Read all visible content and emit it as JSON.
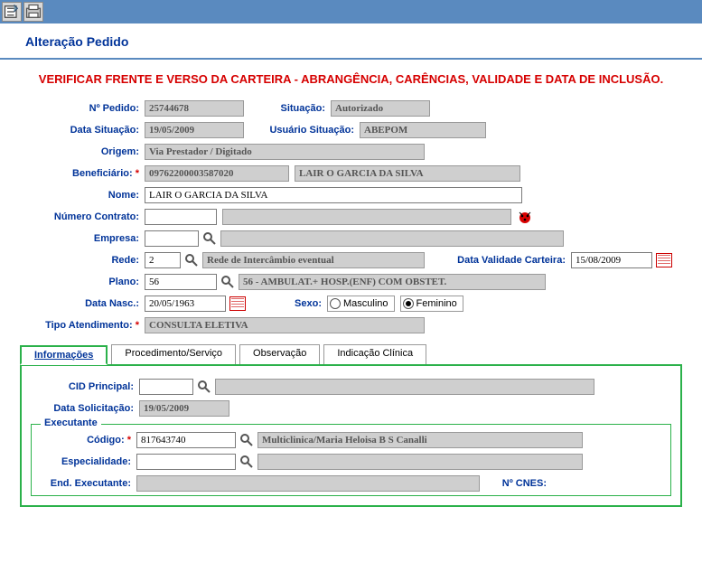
{
  "page": {
    "title": "Alteração Pedido",
    "alert": "VERIFICAR FRENTE E VERSO DA CARTEIRA - ABRANGÊNCIA, CARÊNCIAS, VALIDADE E DATA DE INCLUSÃO."
  },
  "labels": {
    "nopedido": "Nº Pedido:",
    "situacao": "Situação:",
    "data_situacao": "Data Situação:",
    "usuario_situacao": "Usuário Situação:",
    "origem": "Origem:",
    "beneficiario": "Beneficiário:",
    "nome": "Nome:",
    "numero_contrato": "Número Contrato:",
    "empresa": "Empresa:",
    "rede": "Rede:",
    "data_validade_carteira": "Data Validade Carteira:",
    "plano": "Plano:",
    "data_nasc": "Data Nasc.:",
    "sexo": "Sexo:",
    "masculino": "Masculino",
    "feminino": "Feminino",
    "tipo_atendimento": "Tipo Atendimento:",
    "cid_principal": "CID Principal:",
    "data_solicitacao": "Data Solicitação:",
    "executante": "Executante",
    "codigo": "Código:",
    "especialidade": "Especialidade:",
    "end_executante": "End. Executante:",
    "no_cnes": "Nº CNES:"
  },
  "values": {
    "nopedido": "25744678",
    "situacao": "Autorizado",
    "data_situacao": "19/05/2009",
    "usuario_situacao": "ABEPOM",
    "origem": "Via Prestador / Digitado",
    "beneficiario_cod": "09762200003587020",
    "beneficiario_nome": "LAIR O GARCIA DA SILVA",
    "nome": "LAIR O GARCIA DA SILVA",
    "numero_contrato": "",
    "contrato_desc": "",
    "empresa_cod": "",
    "empresa_desc": "",
    "rede_cod": "2",
    "rede_desc": "Rede de Intercâmbio eventual",
    "data_validade_carteira": "15/08/2009",
    "plano_cod": "56",
    "plano_desc": "56 - AMBULAT.+ HOSP.(ENF) COM OBSTET.",
    "data_nasc": "20/05/1963",
    "sexo": "F",
    "tipo_atendimento": "CONSULTA ELETIVA",
    "cid_principal_cod": "",
    "cid_principal_desc": "",
    "data_solicitacao": "19/05/2009",
    "executante_codigo": "817643740",
    "executante_desc": "Multiclinica/Maria Heloisa B S Canalli",
    "especialidade_cod": "",
    "especialidade_desc": ""
  },
  "tabs": {
    "t1": "Informações",
    "t2": "Procedimento/Serviço",
    "t3": "Observação",
    "t4": "Indicação Clínica"
  }
}
